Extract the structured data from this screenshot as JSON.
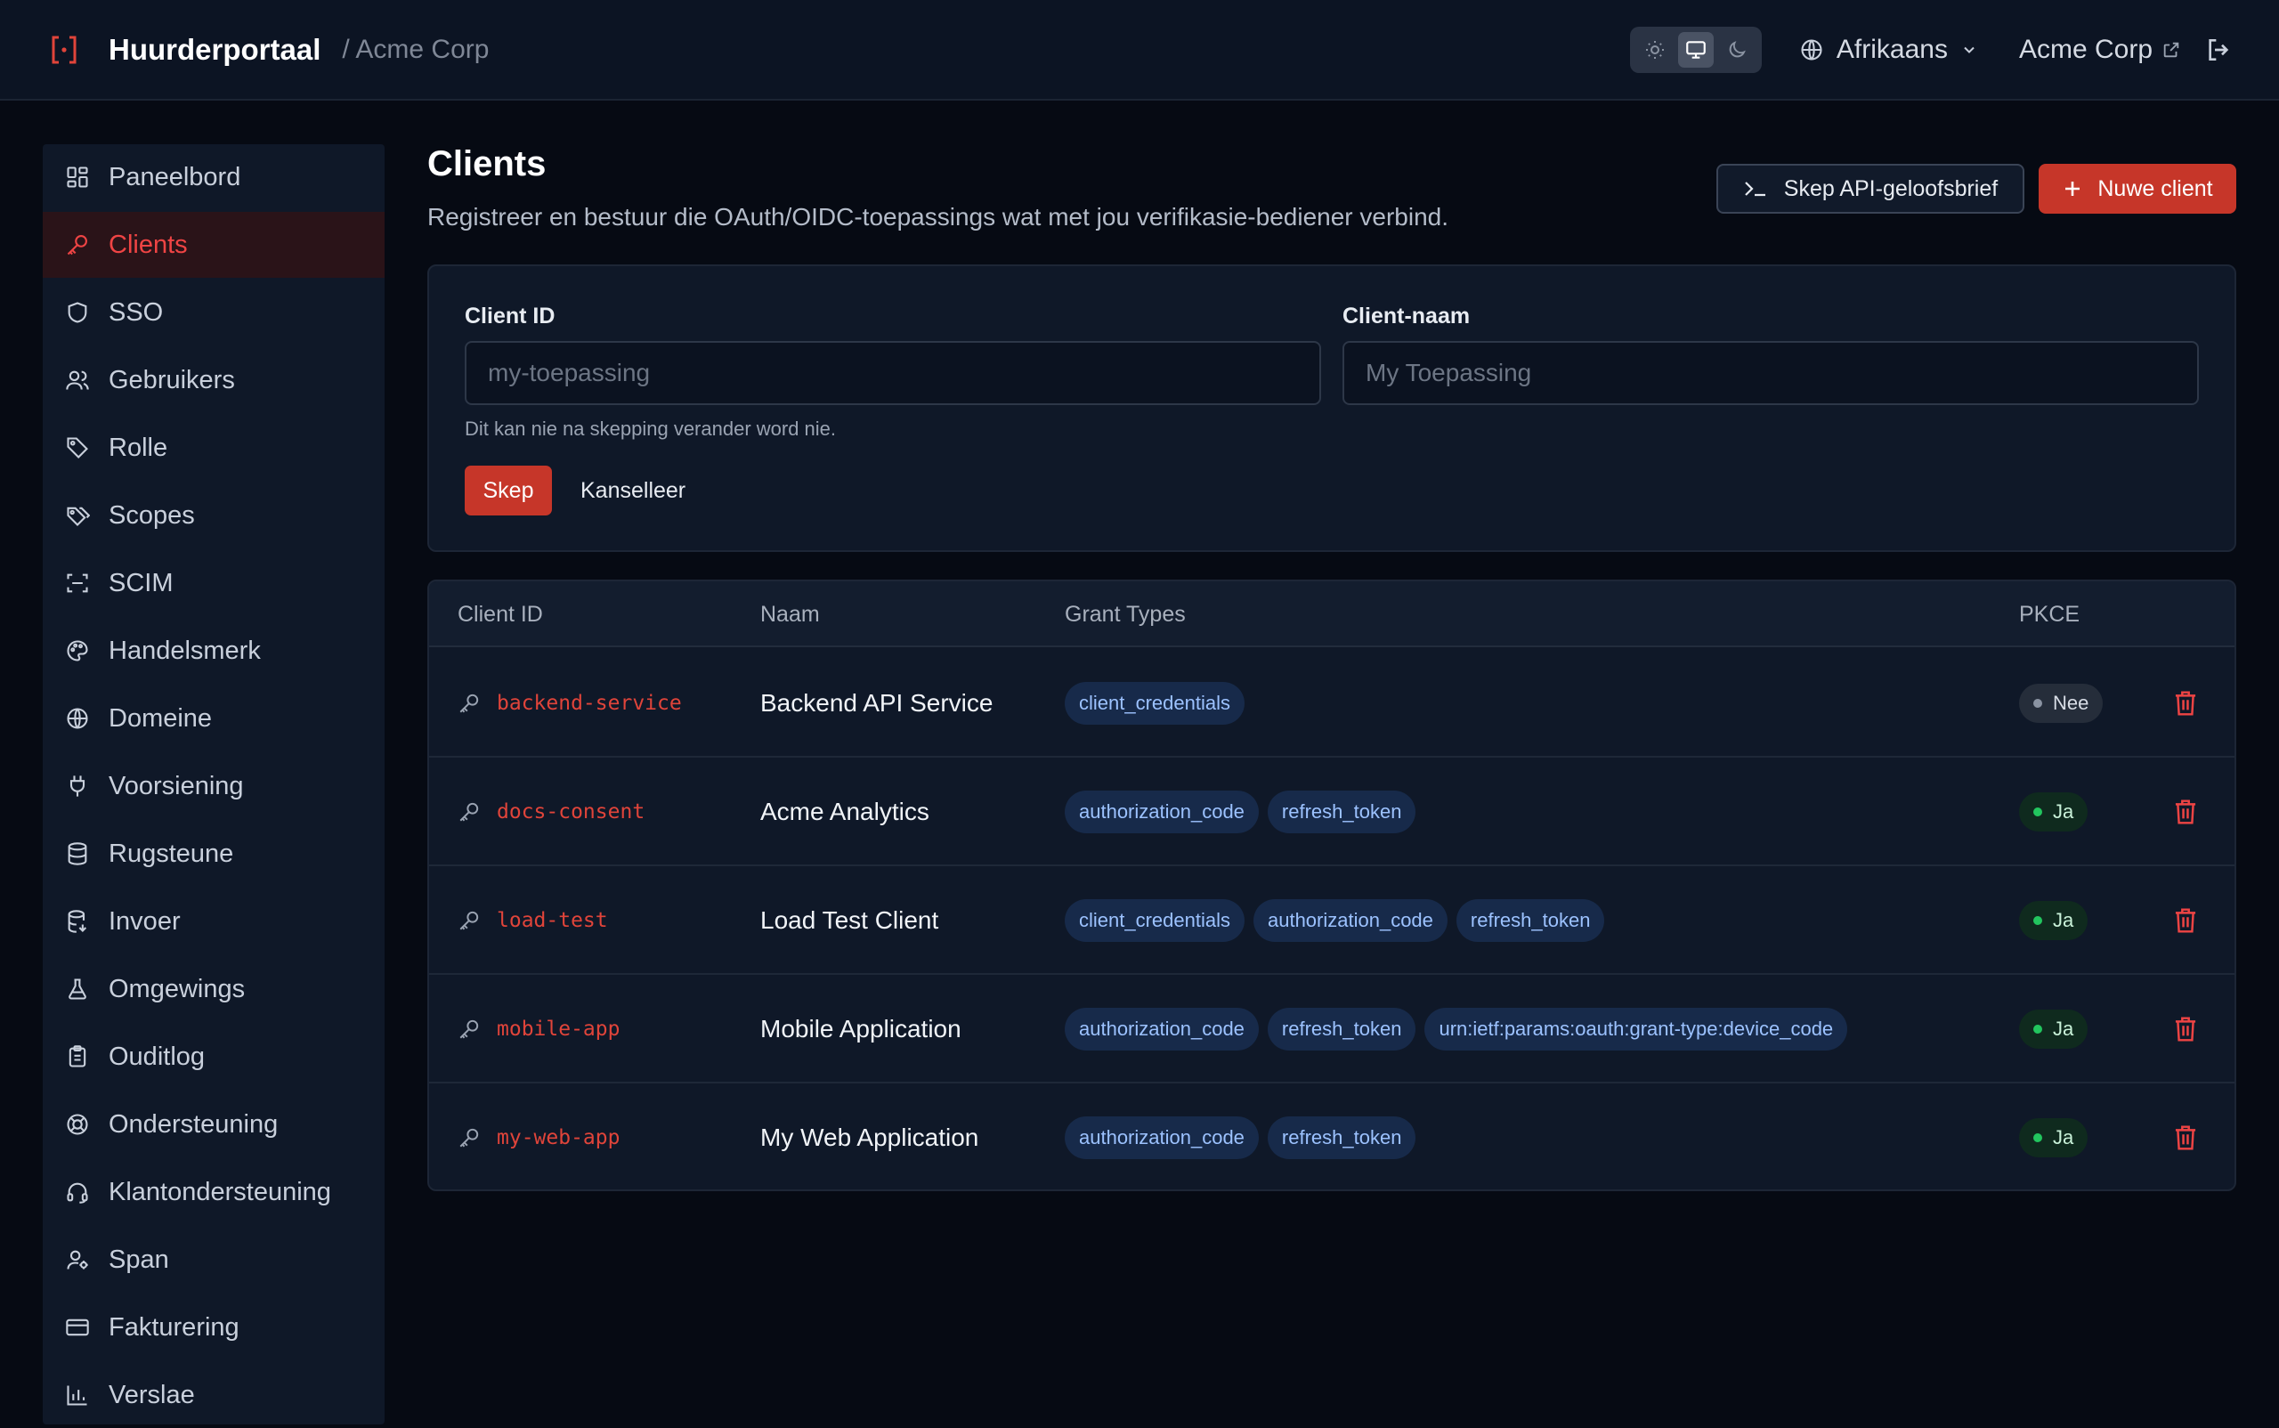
{
  "header": {
    "brand": "Huurderportaal",
    "breadcrumb": "/ Acme Corp",
    "language": "Afrikaans",
    "tenant": "Acme Corp",
    "theme_options": [
      "light",
      "system",
      "dark"
    ],
    "theme_active": "system"
  },
  "sidebar": {
    "items": [
      {
        "label": "Paneelbord",
        "icon": "dashboard-icon"
      },
      {
        "label": "Clients",
        "icon": "key-icon"
      },
      {
        "label": "SSO",
        "icon": "shield-icon"
      },
      {
        "label": "Gebruikers",
        "icon": "users-icon"
      },
      {
        "label": "Rolle",
        "icon": "tag-icon"
      },
      {
        "label": "Scopes",
        "icon": "tags-icon"
      },
      {
        "label": "SCIM",
        "icon": "scan-icon"
      },
      {
        "label": "Handelsmerk",
        "icon": "palette-icon"
      },
      {
        "label": "Domeine",
        "icon": "globe-icon"
      },
      {
        "label": "Voorsiening",
        "icon": "plug-icon"
      },
      {
        "label": "Rugsteune",
        "icon": "database-icon"
      },
      {
        "label": "Invoer",
        "icon": "database-import-icon"
      },
      {
        "label": "Omgewings",
        "icon": "flask-icon"
      },
      {
        "label": "Ouditlog",
        "icon": "clipboard-icon"
      },
      {
        "label": "Ondersteuning",
        "icon": "lifebuoy-icon"
      },
      {
        "label": "Klantondersteuning",
        "icon": "headset-icon"
      },
      {
        "label": "Span",
        "icon": "user-cog-icon"
      },
      {
        "label": "Fakturering",
        "icon": "credit-card-icon"
      },
      {
        "label": "Verslae",
        "icon": "bar-chart-icon"
      }
    ],
    "active_index": 1
  },
  "page": {
    "title": "Clients",
    "subtitle": "Registreer en bestuur die OAuth/OIDC-toepassings wat met jou verifikasie-bediener verbind.",
    "api_button": "Skep API-geloofsbrief",
    "new_button": "Nuwe client"
  },
  "form": {
    "client_id_label": "Client ID",
    "client_id_placeholder": "my-toepassing",
    "client_id_value": "",
    "client_name_label": "Client-naam",
    "client_name_placeholder": "My Toepassing",
    "client_name_value": "",
    "hint": "Dit kan nie na skepping verander word nie.",
    "create_button": "Skep",
    "cancel_button": "Kanselleer"
  },
  "table": {
    "columns": [
      "Client ID",
      "Naam",
      "Grant Types",
      "PKCE"
    ],
    "rows": [
      {
        "client_id": "backend-service",
        "name": "Backend API Service",
        "grants": [
          "client_credentials"
        ],
        "pkce": "Nee",
        "pkce_enabled": false
      },
      {
        "client_id": "docs-consent",
        "name": "Acme Analytics",
        "grants": [
          "authorization_code",
          "refresh_token"
        ],
        "pkce": "Ja",
        "pkce_enabled": true
      },
      {
        "client_id": "load-test",
        "name": "Load Test Client",
        "grants": [
          "client_credentials",
          "authorization_code",
          "refresh_token"
        ],
        "pkce": "Ja",
        "pkce_enabled": true
      },
      {
        "client_id": "mobile-app",
        "name": "Mobile Application",
        "grants": [
          "authorization_code",
          "refresh_token",
          "urn:ietf:params:oauth:grant-type:device_code"
        ],
        "pkce": "Ja",
        "pkce_enabled": true
      },
      {
        "client_id": "my-web-app",
        "name": "My Web Application",
        "grants": [
          "authorization_code",
          "refresh_token"
        ],
        "pkce": "Ja",
        "pkce_enabled": true
      }
    ]
  },
  "colors": {
    "accent": "#c63629",
    "accent_text": "#ef4444",
    "success": "#22c55e",
    "background": "#060a13",
    "surface": "#0f1828"
  }
}
